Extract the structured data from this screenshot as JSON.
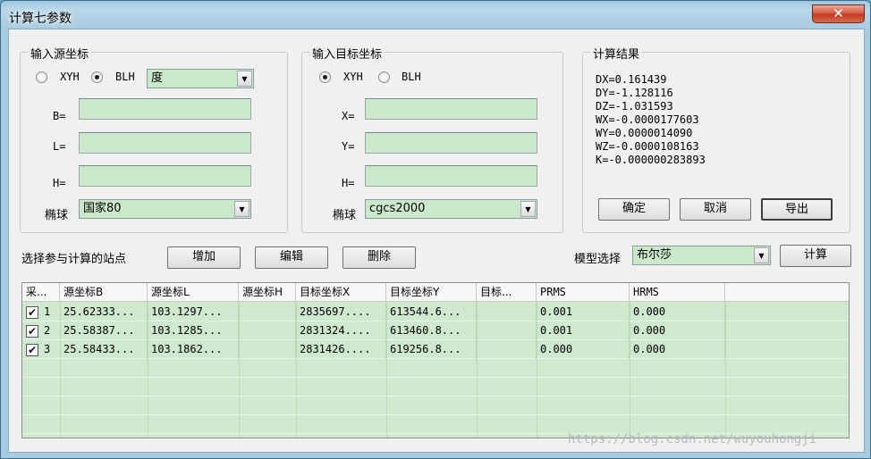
{
  "window": {
    "title": "计算七参数",
    "close_glyph": "✕"
  },
  "source": {
    "legend": "输入源坐标",
    "radio_xyh": "XYH",
    "radio_blh": "BLH",
    "selected": "BLH",
    "unit_value": "度",
    "label_b": "B=",
    "label_l": "L=",
    "label_h": "H=",
    "ellipsoid_label": "椭球",
    "ellipsoid_value": "国家80"
  },
  "target": {
    "legend": "输入目标坐标",
    "radio_xyh": "XYH",
    "radio_blh": "BLH",
    "selected": "XYH",
    "label_x": "X=",
    "label_y": "Y=",
    "label_h": "H=",
    "ellipsoid_label": "椭球",
    "ellipsoid_value": "cgcs2000"
  },
  "results": {
    "legend": "计算结果",
    "lines": [
      "DX=0.161439",
      "DY=-1.128116",
      "DZ=-1.031593",
      "WX=-0.0000177603",
      "WY=0.0000014090",
      "WZ=-0.0000108163",
      "K=-0.000000283893"
    ],
    "ok_button": "确定",
    "cancel_button": "取消",
    "export_button": "导出"
  },
  "stations": {
    "label": "选择参与计算的站点",
    "add_button": "增加",
    "edit_button": "编辑",
    "delete_button": "删除",
    "model_label": "模型选择",
    "model_value": "布尔莎",
    "compute_button": "计算"
  },
  "grid": {
    "columns": [
      "采...",
      "源坐标B",
      "源坐标L",
      "源坐标H",
      "目标坐标X",
      "目标坐标Y",
      "目标...",
      "PRMS",
      "HRMS"
    ],
    "rows": [
      {
        "checked": true,
        "index": "1",
        "b": "25.62333...",
        "l": "103.1297...",
        "h": "",
        "x": "2835697....",
        "y": "613544.6...",
        "t": "",
        "prms": "0.001",
        "hrms": "0.000"
      },
      {
        "checked": true,
        "index": "2",
        "b": "25.58387...",
        "l": "103.1285...",
        "h": "",
        "x": "2831324....",
        "y": "613460.8...",
        "t": "",
        "prms": "0.001",
        "hrms": "0.000"
      },
      {
        "checked": true,
        "index": "3",
        "b": "25.58433...",
        "l": "103.1862...",
        "h": "",
        "x": "2831426....",
        "y": "619256.8...",
        "t": "",
        "prms": "0.000",
        "hrms": "0.000"
      }
    ]
  },
  "watermark": "https://blog.csdn.net/wuyouhongji",
  "colors": {
    "field_bg": "#cbe8cb",
    "frame": "#a7cbe0",
    "close": "#c1381c"
  }
}
